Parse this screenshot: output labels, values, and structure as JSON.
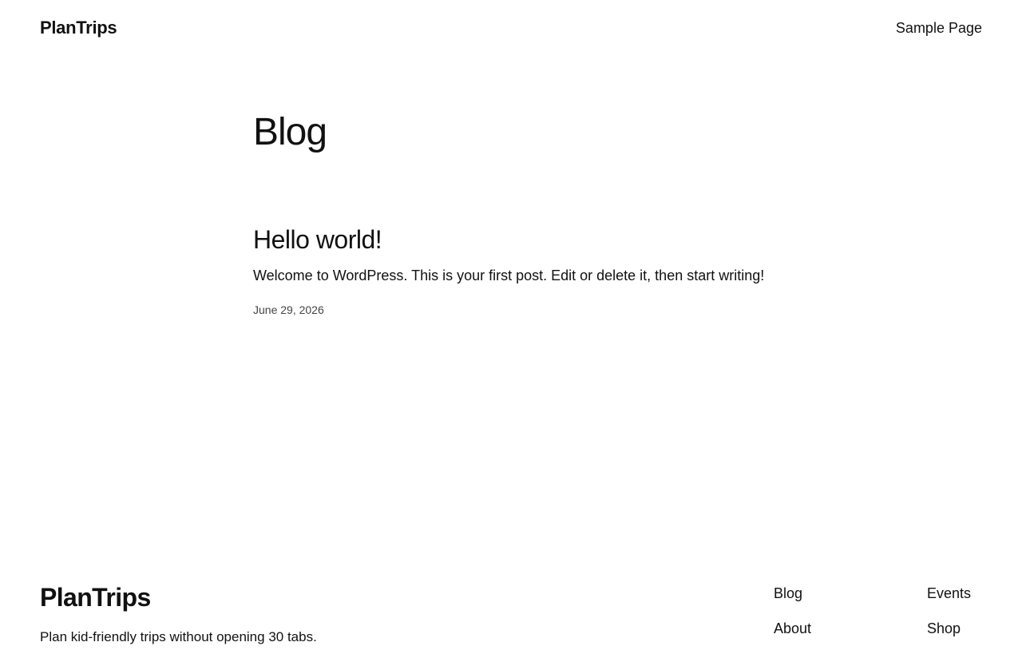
{
  "header": {
    "site_title": "PlanTrips",
    "nav": [
      "Sample Page"
    ]
  },
  "main": {
    "page_title": "Blog",
    "posts": [
      {
        "title": "Hello world!",
        "excerpt": "Welcome to WordPress. This is your first post. Edit or delete it, then start writing!",
        "date": "June 29, 2026"
      }
    ]
  },
  "footer": {
    "site_title": "PlanTrips",
    "tagline": "Plan kid-friendly trips without opening 30 tabs.",
    "nav_col_1": [
      "Blog",
      "About"
    ],
    "nav_col_2": [
      "Events",
      "Shop"
    ]
  }
}
